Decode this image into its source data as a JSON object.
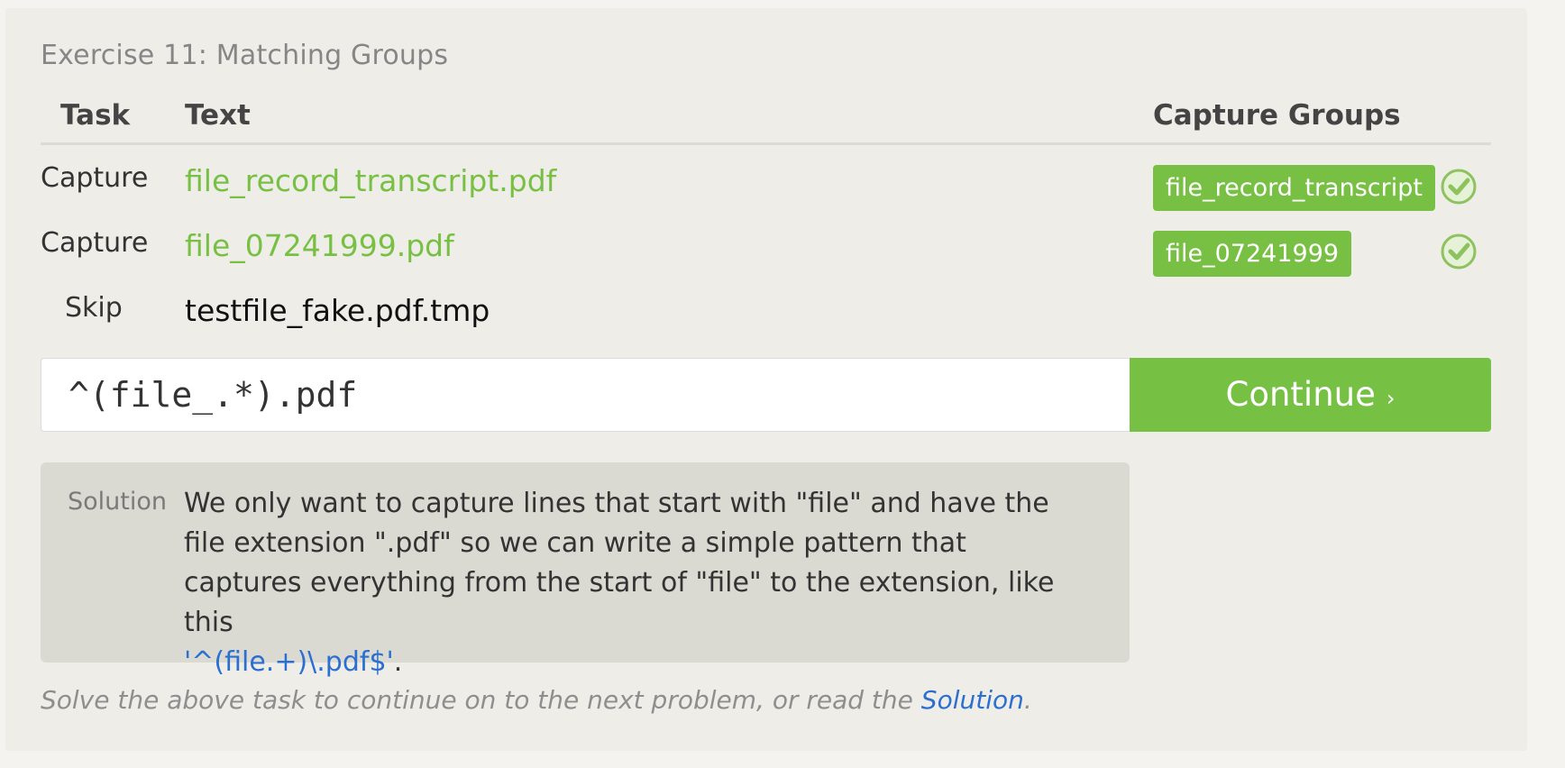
{
  "exercise": {
    "title": "Exercise 11: Matching Groups"
  },
  "table": {
    "headers": {
      "task": "Task",
      "text": "Text",
      "groups": "Capture Groups"
    },
    "rows": [
      {
        "task": "Capture",
        "text": "file_record_transcript.pdf",
        "group": "file_record_transcript",
        "status": "check-icon"
      },
      {
        "task": "Capture",
        "text": "file_07241999.pdf",
        "group": "file_07241999",
        "status": "check-icon"
      },
      {
        "task": "Skip",
        "text": "testfile_fake.pdf.tmp"
      }
    ]
  },
  "input": {
    "value": "^(file_.*).pdf"
  },
  "continue_button": {
    "label": "Continue",
    "chevron": "›"
  },
  "solution": {
    "label": "Solution",
    "text": "We only want to capture lines that start with \"file\" and have the file extension \".pdf\" so we can write a simple pattern that captures everything from the start of \"file\" to the extension, like this",
    "code": "'^(file.+)\\.pdf$'",
    "end": "."
  },
  "hint": {
    "text": "Solve the above task to continue on to the next problem, or read the",
    "link": "Solution",
    "end": "."
  },
  "colors": {
    "accent": "#78c044",
    "link": "#2b6fd0",
    "panel": "#efede8"
  }
}
